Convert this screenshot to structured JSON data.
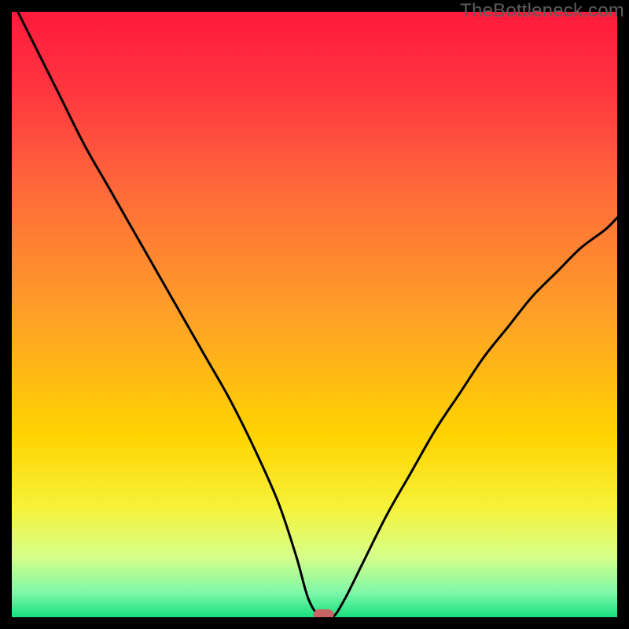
{
  "watermark": "TheBottleneck.com",
  "chart_data": {
    "type": "line",
    "title": "",
    "xlabel": "",
    "ylabel": "",
    "xlim": [
      0,
      100
    ],
    "ylim": [
      0,
      100
    ],
    "series": [
      {
        "name": "curve",
        "x": [
          0,
          4,
          8,
          12,
          16,
          20,
          24,
          28,
          32,
          36,
          40,
          44,
          47,
          49,
          51,
          53,
          55,
          58,
          62,
          66,
          70,
          74,
          78,
          82,
          86,
          90,
          94,
          98,
          100
        ],
        "y": [
          102,
          94,
          86,
          78,
          71,
          64,
          57,
          50,
          43,
          36,
          28,
          19,
          10,
          3,
          0,
          0,
          3,
          9,
          17,
          24,
          31,
          37,
          43,
          48,
          53,
          57,
          61,
          64,
          66
        ]
      }
    ],
    "marker": {
      "x": 51.5,
      "y": 0
    },
    "gradient_stops": [
      {
        "pos": 0.0,
        "color": "#ff1a3c"
      },
      {
        "pos": 0.12,
        "color": "#ff3340"
      },
      {
        "pos": 0.3,
        "color": "#ff6b3a"
      },
      {
        "pos": 0.5,
        "color": "#ffa028"
      },
      {
        "pos": 0.7,
        "color": "#ffd400"
      },
      {
        "pos": 0.82,
        "color": "#f6f23a"
      },
      {
        "pos": 0.9,
        "color": "#d6ff8a"
      },
      {
        "pos": 0.96,
        "color": "#7ef7a8"
      },
      {
        "pos": 1.0,
        "color": "#16e07f"
      }
    ]
  }
}
